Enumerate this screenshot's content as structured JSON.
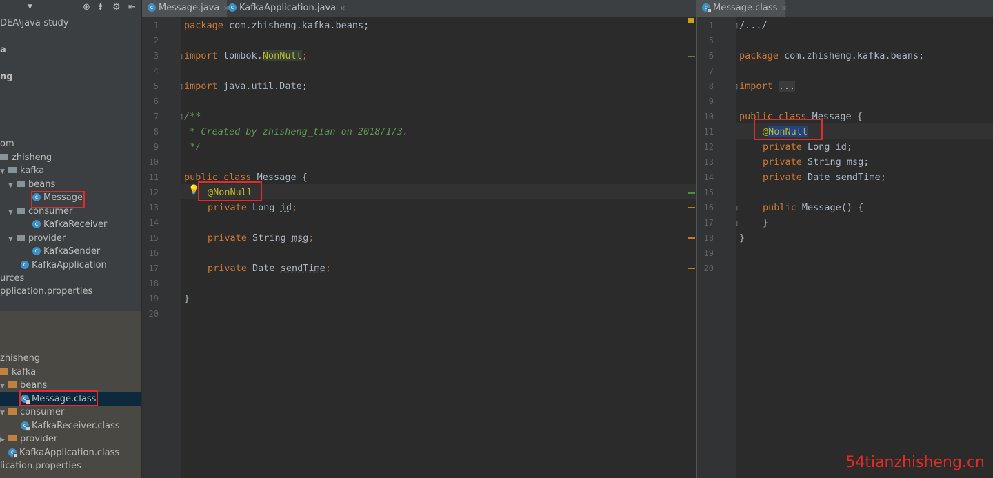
{
  "project_tree": {
    "path": "DEA\\java-study",
    "items_top": [
      {
        "label": "a"
      },
      {
        "label": "ng"
      },
      {
        "label": "om"
      },
      {
        "label": "zhisheng"
      },
      {
        "label": "kafka"
      },
      {
        "label": "beans"
      },
      {
        "label": "Message"
      },
      {
        "label": "consumer"
      },
      {
        "label": "KafkaReceiver"
      },
      {
        "label": "provider"
      },
      {
        "label": "KafkaSender"
      },
      {
        "label": "KafkaApplication"
      },
      {
        "label": "urces"
      },
      {
        "label": "pplication.properties"
      }
    ],
    "items_lib": [
      {
        "label": "zhisheng"
      },
      {
        "label": "kafka"
      },
      {
        "label": "beans"
      },
      {
        "label": "Message.class"
      },
      {
        "label": "consumer"
      },
      {
        "label": "KafkaReceiver.class"
      },
      {
        "label": "provider"
      },
      {
        "label": "KafkaApplication.class"
      },
      {
        "label": "lication.properties"
      }
    ]
  },
  "left_editor": {
    "tabs": [
      {
        "label": "Message.java",
        "close": "×"
      },
      {
        "label": "KafkaApplication.java",
        "close": "×"
      }
    ],
    "line_numbers": [
      "1",
      "2",
      "3",
      "4",
      "5",
      "6",
      "7",
      "8",
      "9",
      "10",
      "11",
      "12",
      "13",
      "14",
      "15",
      "16",
      "17",
      "18",
      "19",
      "20"
    ],
    "code": {
      "l1_kw": "package",
      "l1_rest": " com.zhisheng.kafka.beans;",
      "l3_kw": "import",
      "l3_a": " lombok.",
      "l3_ref": "NonNull",
      "l3_semi": ";",
      "l5_kw": "import",
      "l5_rest": " java.util.Date;",
      "l7": "/**",
      "l8": " * Created by zhisheng_tian on 2018/1/3.",
      "l9": " */",
      "l11_kw": "public class",
      "l11_rest": " Message {",
      "l12_ann": "@NonNull",
      "l13_kw": "private",
      "l13_rest": " Long ",
      "l13_f": "id",
      "l13_s": ";",
      "l15_kw": "private",
      "l15_rest": " String ",
      "l15_f": "msg",
      "l15_s": ";",
      "l17_kw": "private",
      "l17_rest": " Date ",
      "l17_f": "sendTime",
      "l17_s": ";",
      "l19": "}"
    }
  },
  "right_editor": {
    "tabs": [
      {
        "label": "Message.class",
        "close": "×"
      }
    ],
    "line_numbers": [
      "1",
      "5",
      "6",
      "7",
      "8",
      "9",
      "10",
      "11",
      "12",
      "13",
      "14",
      "15",
      "16",
      "17",
      "18",
      "19",
      "20"
    ],
    "code": {
      "l1": "/.../",
      "l6_kw": "package",
      "l6_rest": " com.zhisheng.kafka.beans;",
      "l8_kw": "import",
      "l8_rest": "...",
      "l11_kw": "public class",
      "l11_rest": " Message {",
      "l12_at": "@",
      "l12_ann": "NonNull",
      "l13_kw": "private",
      "l13_rest": " Long id;",
      "l14_kw": "private",
      "l14_rest": " String msg;",
      "l15_kw": "private",
      "l15_rest": " Date sendTime;",
      "l17_kw": "public",
      "l17_rest": " Message() {",
      "l18": "}",
      "l19": "}"
    }
  },
  "watermark": "54tianzhisheng.cn",
  "colors": {
    "highlight_box": "#e52a2a",
    "keyword": "#cc7832",
    "annotation": "#bbb529",
    "comment": "#629755"
  }
}
